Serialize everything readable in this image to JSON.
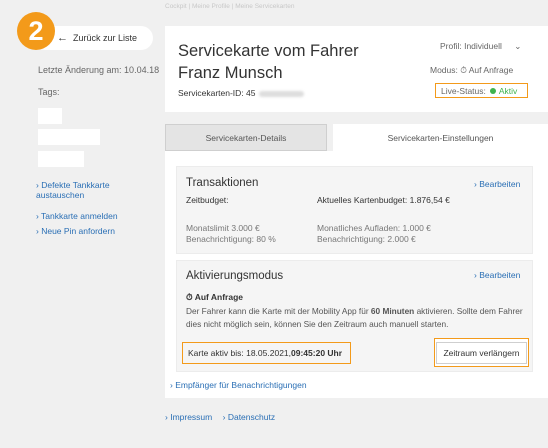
{
  "step_badge": "2",
  "breadcrumb": "Cockpit | Meine Profile | Meine Servicekarten",
  "sidebar": {
    "back_label": "Zurück zur Liste",
    "last_change": "Letzte Änderung am: 10.04.18",
    "tags_label": "Tags:",
    "links": [
      "Defekte Tankkarte austauschen",
      "Tankkarte anmelden",
      "Neue Pin anfordern"
    ]
  },
  "header": {
    "title": "Servicekarte vom Fahrer Franz Munsch",
    "card_id_label": "Servicekarten-ID: 45",
    "profile": "Profil:  Individuell",
    "modus": "Modus:  ⏱  Auf Anfrage",
    "live_label": "Live-Status:",
    "live_value": "Aktiv"
  },
  "tabs": [
    "Servicekarten-Details",
    "Servicekarten-Einstellungen"
  ],
  "transactions": {
    "title": "Transaktionen",
    "edit": "Bearbeiten",
    "budget_label": "Zeitbudget:",
    "current_budget": "Aktuelles Kartenbudget: 1.876,54 €",
    "monthly_limit": "Monatslimit 3.000 €",
    "notification_left": "Benachrichtigung: 80 %",
    "monthly_topup": "Monatliches Aufladen: 1.000 €",
    "notification_right": "Benachrichtigung: 2.000 €"
  },
  "activation": {
    "title": "Aktivierungsmodus",
    "edit": "Bearbeiten",
    "mode": "Auf Anfrage",
    "desc_1": "Der Fahrer kann die Karte mit der Mobility App für ",
    "desc_bold": "60 Minuten",
    "desc_2": " aktivieren. Sollte dem Fahrer dies nicht möglich sein, können Sie den Zeitraum auch manuell starten.",
    "until_label": "Karte aktiv bis: 18.05.2021, ",
    "until_time": "09:45:20 Uhr",
    "extend_button": "Zeitraum verlängern"
  },
  "recipients_link": "Empfänger für Benachrichtigungen",
  "footer": [
    "Impressum",
    "Datenschutz"
  ],
  "colors": {
    "accent_orange": "#f39a1a",
    "link_blue": "#2a6fb5",
    "status_green": "#3fb34f"
  }
}
